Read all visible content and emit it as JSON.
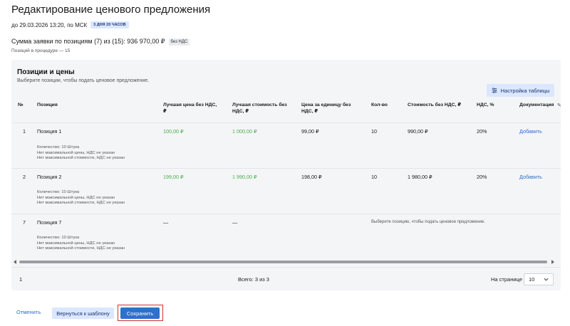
{
  "header": {
    "title": "Редактирование ценового предложения",
    "deadline": "до 29.03.2026 13:20, по МСК",
    "time_badge": "3 ДНЯ 20 ЧАСОВ",
    "sum_text": "Сумма заявки по позициям (7) из (15): 936 970,00 ₽",
    "vat_badge": "без НДС",
    "in_procedure": "Позиций в процедуре — 15"
  },
  "panel": {
    "title": "Позиции и цены",
    "subtitle": "Выберите позиции, чтобы подать ценовое предложение.",
    "settings_button": "Настройка таблицы"
  },
  "table": {
    "headers": {
      "num": "№",
      "position": "Позиция",
      "best_price_line1": "Лучшая цена без НДС,",
      "best_price_line2": "₽",
      "best_cost_line1": "Лучшая стоимость без",
      "best_cost_line2": "НДС, ₽",
      "unit_price_line1": "Цена за единицу без",
      "unit_price_line2": "НДС, ₽",
      "qty": "Кол-во",
      "cost": "Стоимость без НДС, ₽",
      "vat": "НДС, %",
      "docs": "Документация"
    },
    "rows": [
      {
        "num": "1",
        "name": "Позиция 1",
        "best_price": "100,00 ₽",
        "best_cost": "1 000,00 ₽",
        "unit_price": "99,00 ₽",
        "qty": "10",
        "cost": "990,00 ₽",
        "vat": "20%",
        "docs": "Добавить",
        "detail1": "Количество: 10 Штука",
        "detail2": "Нет максимальной цены, НДС не указан",
        "detail3": "Нет максимальной стоимости, НДС не указан"
      },
      {
        "num": "2",
        "name": "Позиция 2",
        "best_price": "199,00 ₽",
        "best_cost": "1 990,00 ₽",
        "unit_price": "198,00 ₽",
        "qty": "10",
        "cost": "1 980,00 ₽",
        "vat": "20%",
        "docs": "Добавить",
        "detail1": "Количество: 10 Штука",
        "detail2": "Нет максимальной цены, НДС не указан",
        "detail3": "Нет максимальной стоимости, НДС не указан"
      },
      {
        "num": "7",
        "name": "Позиция 7",
        "best_price": "—",
        "best_cost": "—",
        "note": "Выберите позицию, чтобы подать ценовое предложение.",
        "detail1": "Количество: 10 Штука",
        "detail2": "Нет максимальной цены, НДС не указан",
        "detail3": "Нет максимальной стоимости, НДС не указан"
      }
    ]
  },
  "pagination": {
    "page": "1",
    "total": "Всего: 3 из 3",
    "per_page_label": "На странице",
    "per_page_value": "10"
  },
  "footer": {
    "cancel": "Отменить",
    "back_to_template": "Вернуться к шаблону",
    "save": "Сохранить"
  },
  "colors": {
    "accent": "#2f6fce",
    "green_price": "#4cae4c",
    "highlight_outline": "#d0342c"
  }
}
